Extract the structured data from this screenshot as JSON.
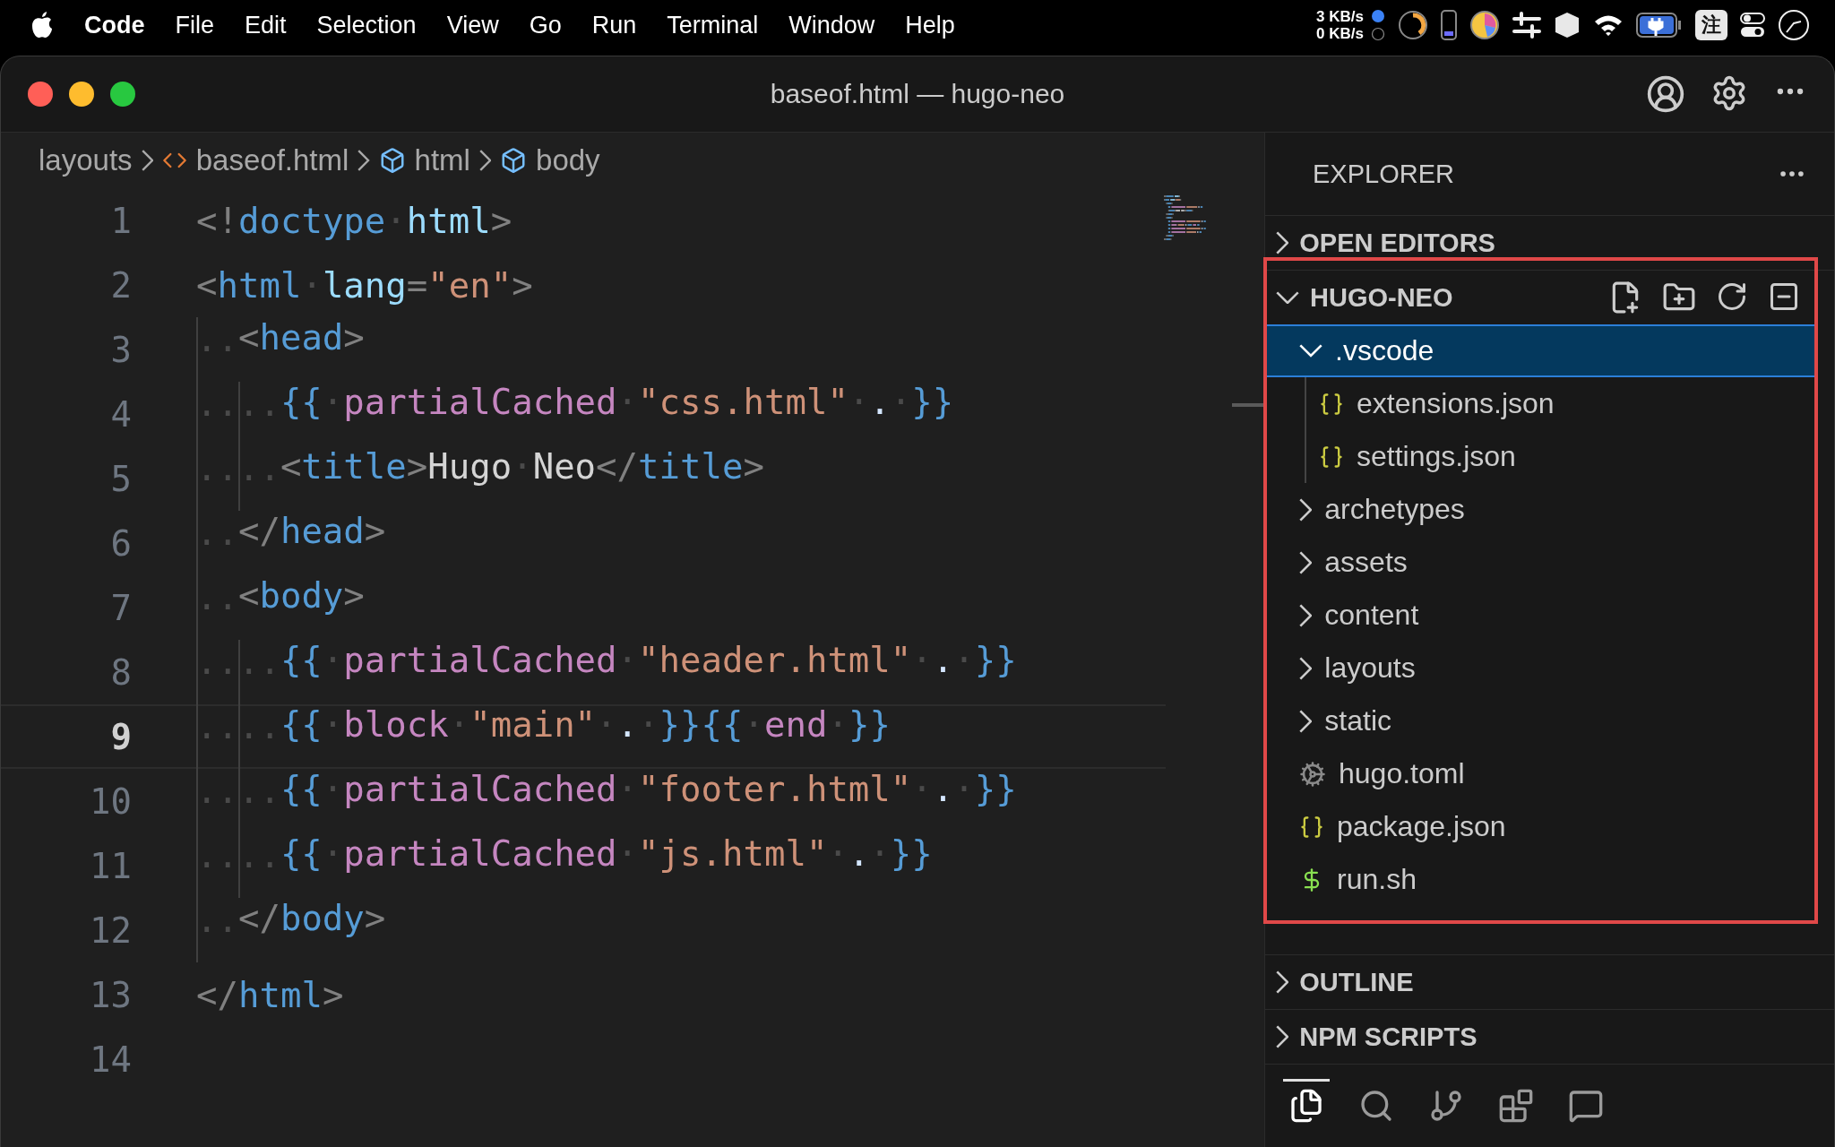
{
  "menu_bar": {
    "app_name": "Code",
    "menus": [
      "File",
      "Edit",
      "Selection",
      "View",
      "Go",
      "Run",
      "Terminal",
      "Window",
      "Help"
    ],
    "network": [
      "3 KB/s",
      "0 KB/s"
    ],
    "input_method": "注"
  },
  "window": {
    "title": "baseof.html — hugo-neo"
  },
  "breadcrumbs": [
    {
      "label": "layouts",
      "kind": "folder"
    },
    {
      "label": "baseof.html",
      "kind": "file"
    },
    {
      "label": "html",
      "kind": "symbol"
    },
    {
      "label": "body",
      "kind": "symbol"
    }
  ],
  "editor": {
    "lines": [
      {
        "number": "1",
        "current": false,
        "code": [
          {
            "kind": "punct",
            "text": "<!"
          },
          {
            "kind": "tag",
            "text": "doctype"
          },
          {
            "kind": "space",
            "text": "·"
          },
          {
            "kind": "attr",
            "text": "html"
          },
          {
            "kind": "punct",
            "text": ">"
          }
        ]
      },
      {
        "number": "2",
        "current": false,
        "code": [
          {
            "kind": "punct",
            "text": "<"
          },
          {
            "kind": "tag",
            "text": "html"
          },
          {
            "kind": "space",
            "text": "·"
          },
          {
            "kind": "attr",
            "text": "lang"
          },
          {
            "kind": "punct",
            "text": "="
          },
          {
            "kind": "string",
            "text": "\"en\""
          },
          {
            "kind": "punct",
            "text": ">"
          }
        ]
      },
      {
        "number": "3",
        "current": false,
        "code": [
          {
            "kind": "indent",
            "text": "··"
          },
          {
            "kind": "punct",
            "text": "<"
          },
          {
            "kind": "tag",
            "text": "head"
          },
          {
            "kind": "punct",
            "text": ">"
          }
        ]
      },
      {
        "number": "4",
        "current": false,
        "code": [
          {
            "kind": "indent",
            "text": "····"
          },
          {
            "kind": "brace",
            "text": "{{"
          },
          {
            "kind": "space",
            "text": "·"
          },
          {
            "kind": "func",
            "text": "partialCached"
          },
          {
            "kind": "space",
            "text": "·"
          },
          {
            "kind": "string",
            "text": "\"css.html\""
          },
          {
            "kind": "space",
            "text": "·"
          },
          {
            "kind": "op",
            "text": "."
          },
          {
            "kind": "space",
            "text": "·"
          },
          {
            "kind": "brace",
            "text": "}}"
          }
        ]
      },
      {
        "number": "5",
        "current": false,
        "code": [
          {
            "kind": "indent",
            "text": "····"
          },
          {
            "kind": "punct",
            "text": "<"
          },
          {
            "kind": "tag",
            "text": "title"
          },
          {
            "kind": "punct",
            "text": ">"
          },
          {
            "kind": "text",
            "text": "Hugo"
          },
          {
            "kind": "space",
            "text": "·"
          },
          {
            "kind": "text",
            "text": "Neo"
          },
          {
            "kind": "punct",
            "text": "</"
          },
          {
            "kind": "tag",
            "text": "title"
          },
          {
            "kind": "punct",
            "text": ">"
          }
        ]
      },
      {
        "number": "6",
        "current": false,
        "code": [
          {
            "kind": "indent",
            "text": "··"
          },
          {
            "kind": "punct",
            "text": "</"
          },
          {
            "kind": "tag",
            "text": "head"
          },
          {
            "kind": "punct",
            "text": ">"
          }
        ]
      },
      {
        "number": "7",
        "current": false,
        "code": [
          {
            "kind": "indent",
            "text": "··"
          },
          {
            "kind": "punct",
            "text": "<"
          },
          {
            "kind": "tag",
            "text": "body"
          },
          {
            "kind": "punct",
            "text": ">"
          }
        ]
      },
      {
        "number": "8",
        "current": false,
        "code": [
          {
            "kind": "indent",
            "text": "····"
          },
          {
            "kind": "brace",
            "text": "{{"
          },
          {
            "kind": "space",
            "text": "·"
          },
          {
            "kind": "func",
            "text": "partialCached"
          },
          {
            "kind": "space",
            "text": "·"
          },
          {
            "kind": "string",
            "text": "\"header.html\""
          },
          {
            "kind": "space",
            "text": "·"
          },
          {
            "kind": "op",
            "text": "."
          },
          {
            "kind": "space",
            "text": "·"
          },
          {
            "kind": "brace",
            "text": "}}"
          }
        ]
      },
      {
        "number": "9",
        "current": true,
        "code": [
          {
            "kind": "indent",
            "text": "····"
          },
          {
            "kind": "brace",
            "text": "{{"
          },
          {
            "kind": "space",
            "text": "·"
          },
          {
            "kind": "func",
            "text": "block"
          },
          {
            "kind": "space",
            "text": "·"
          },
          {
            "kind": "string",
            "text": "\"main\""
          },
          {
            "kind": "space",
            "text": "·"
          },
          {
            "kind": "op",
            "text": "."
          },
          {
            "kind": "space",
            "text": "·"
          },
          {
            "kind": "brace",
            "text": "}}{{"
          },
          {
            "kind": "space",
            "text": "·"
          },
          {
            "kind": "func",
            "text": "end"
          },
          {
            "kind": "space",
            "text": "·"
          },
          {
            "kind": "brace",
            "text": "}}"
          }
        ]
      },
      {
        "number": "10",
        "current": false,
        "code": [
          {
            "kind": "indent",
            "text": "····"
          },
          {
            "kind": "brace",
            "text": "{{"
          },
          {
            "kind": "space",
            "text": "·"
          },
          {
            "kind": "func",
            "text": "partialCached"
          },
          {
            "kind": "space",
            "text": "·"
          },
          {
            "kind": "string",
            "text": "\"footer.html\""
          },
          {
            "kind": "space",
            "text": "·"
          },
          {
            "kind": "op",
            "text": "."
          },
          {
            "kind": "space",
            "text": "·"
          },
          {
            "kind": "brace",
            "text": "}}"
          }
        ]
      },
      {
        "number": "11",
        "current": false,
        "code": [
          {
            "kind": "indent",
            "text": "····"
          },
          {
            "kind": "brace",
            "text": "{{"
          },
          {
            "kind": "space",
            "text": "·"
          },
          {
            "kind": "func",
            "text": "partialCached"
          },
          {
            "kind": "space",
            "text": "·"
          },
          {
            "kind": "string",
            "text": "\"js.html\""
          },
          {
            "kind": "space",
            "text": "·"
          },
          {
            "kind": "op",
            "text": "."
          },
          {
            "kind": "space",
            "text": "·"
          },
          {
            "kind": "brace",
            "text": "}}"
          }
        ]
      },
      {
        "number": "12",
        "current": false,
        "code": [
          {
            "kind": "indent",
            "text": "··"
          },
          {
            "kind": "punct",
            "text": "</"
          },
          {
            "kind": "tag",
            "text": "body"
          },
          {
            "kind": "punct",
            "text": ">"
          }
        ]
      },
      {
        "number": "13",
        "current": false,
        "code": [
          {
            "kind": "punct",
            "text": "</"
          },
          {
            "kind": "tag",
            "text": "html"
          },
          {
            "kind": "punct",
            "text": ">"
          }
        ]
      },
      {
        "number": "14",
        "current": false
      }
    ]
  },
  "explorer": {
    "title": "EXPLORER",
    "sections": [
      {
        "title": "OPEN EDITORS",
        "expanded": false,
        "annotated": false
      },
      {
        "title": "HUGO-NEO",
        "expanded": true,
        "annotated": true,
        "tree": [
          {
            "name": ".vscode",
            "kind": "folder",
            "expanded": true,
            "selected": true,
            "children": [
              {
                "name": "extensions.json",
                "kind": "json",
                "selected": false
              },
              {
                "name": "settings.json",
                "kind": "json",
                "selected": false
              }
            ]
          },
          {
            "name": "archetypes",
            "kind": "folder",
            "expanded": false,
            "selected": false
          },
          {
            "name": "assets",
            "kind": "folder",
            "expanded": false,
            "selected": false
          },
          {
            "name": "content",
            "kind": "folder",
            "expanded": false,
            "selected": false
          },
          {
            "name": "layouts",
            "kind": "folder",
            "expanded": false,
            "selected": false
          },
          {
            "name": "static",
            "kind": "folder",
            "expanded": false,
            "selected": false
          },
          {
            "name": "hugo.toml",
            "kind": "config",
            "selected": false
          },
          {
            "name": "package.json",
            "kind": "json",
            "selected": false
          },
          {
            "name": "run.sh",
            "kind": "shell",
            "selected": false
          }
        ]
      },
      {
        "title": "OUTLINE",
        "expanded": false,
        "annotated": false
      },
      {
        "title": "NPM SCRIPTS",
        "expanded": false,
        "annotated": false
      }
    ]
  },
  "activity_bar": [
    {
      "kind": "explorer",
      "selected": true
    },
    {
      "kind": "search",
      "selected": false
    },
    {
      "kind": "source-control",
      "selected": false
    },
    {
      "kind": "extensions",
      "selected": false
    },
    {
      "kind": "chat",
      "selected": false
    }
  ]
}
